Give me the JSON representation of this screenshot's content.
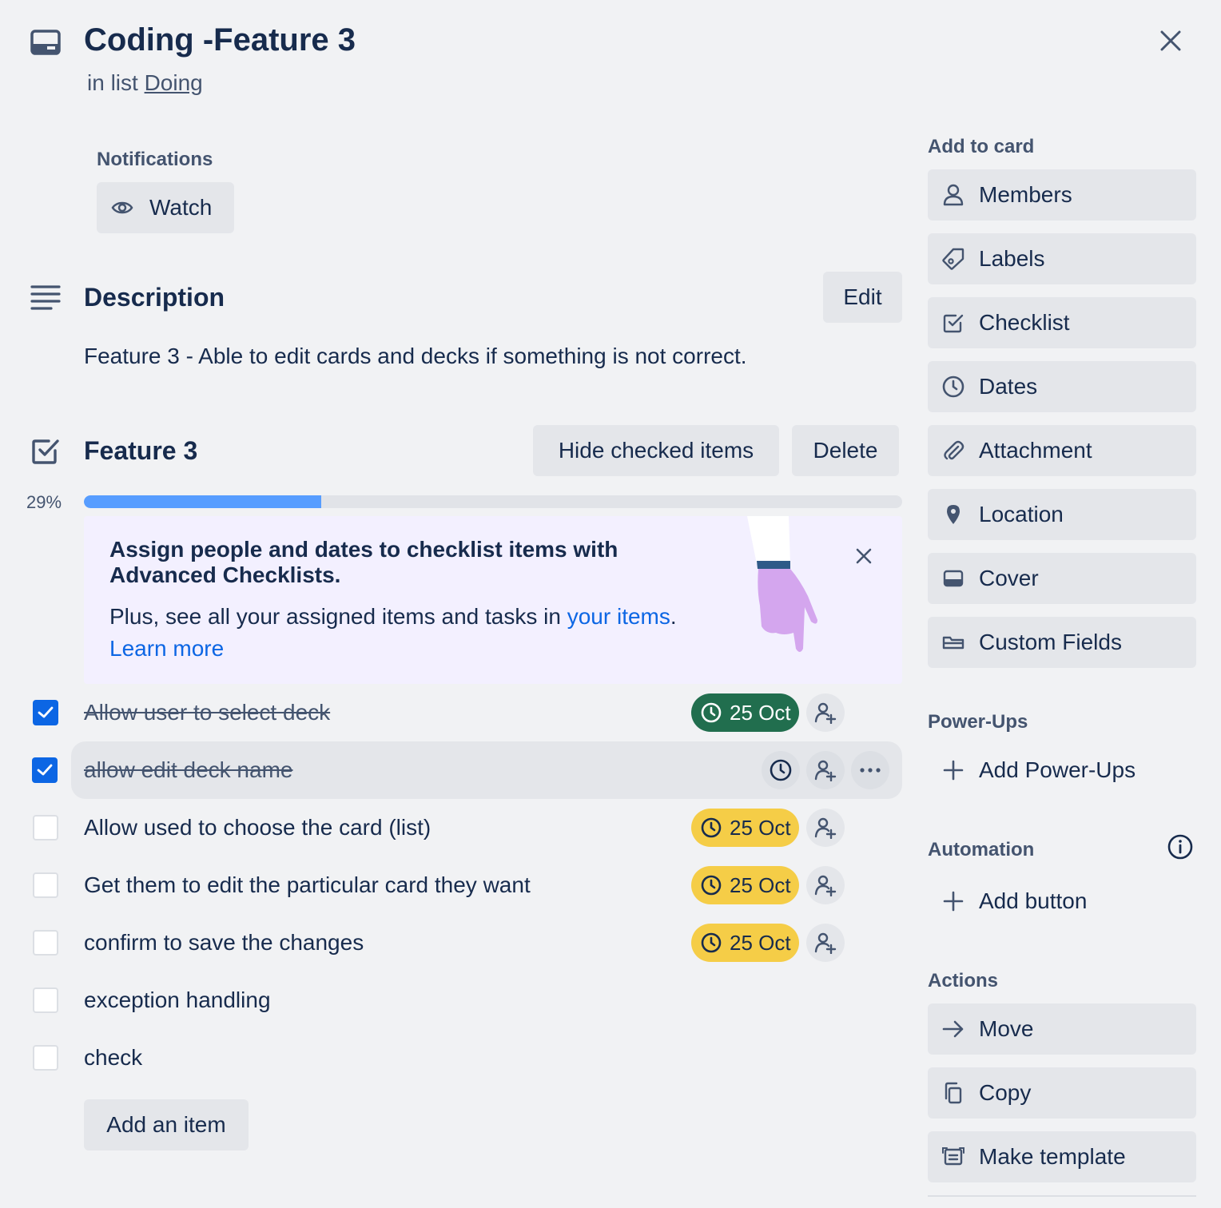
{
  "card": {
    "title": "Coding -Feature 3",
    "subtitle_prefix": "in list",
    "list_name": "Doing"
  },
  "notifications": {
    "heading": "Notifications",
    "watch_label": "Watch"
  },
  "description": {
    "heading": "Description",
    "edit_label": "Edit",
    "text": "Feature 3 - Able to edit cards and decks if something is not correct."
  },
  "checklist": {
    "title": "Feature 3",
    "hide_checked_label": "Hide checked items",
    "delete_label": "Delete",
    "progress_text": "29%",
    "progress_value": 0.29,
    "add_item_label": "Add an item",
    "items": [
      {
        "text": "Allow user to select deck",
        "checked": true,
        "due": "25 Oct",
        "due_status": "complete"
      },
      {
        "text": "allow edit deck name",
        "checked": true,
        "due": "",
        "due_status": "none"
      },
      {
        "text": "Allow used to choose the card (list)",
        "checked": false,
        "due": "25 Oct",
        "due_status": "due-soon"
      },
      {
        "text": "Get them to edit the particular card they want",
        "checked": false,
        "due": "25 Oct",
        "due_status": "due-soon"
      },
      {
        "text": "confirm to save the changes",
        "checked": false,
        "due": "25 Oct",
        "due_status": "due-soon"
      },
      {
        "text": "exception handling",
        "checked": false,
        "due": "",
        "due_status": "none"
      },
      {
        "text": "check",
        "checked": false,
        "due": "",
        "due_status": "none"
      }
    ]
  },
  "promo": {
    "title": "Assign people and dates to checklist items with Advanced Checklists.",
    "text_before": "Plus, see all your assigned items and tasks in ",
    "link_text": "your items",
    "text_after": ".",
    "learn_more": "Learn more"
  },
  "sidebar": {
    "add_to_card_heading": "Add to card",
    "add_to_card": [
      {
        "label": "Members",
        "icon": "person-icon"
      },
      {
        "label": "Labels",
        "icon": "tag-icon"
      },
      {
        "label": "Checklist",
        "icon": "checkbox-icon"
      },
      {
        "label": "Dates",
        "icon": "clock-icon"
      },
      {
        "label": "Attachment",
        "icon": "paperclip-icon"
      },
      {
        "label": "Location",
        "icon": "location-pin-icon"
      },
      {
        "label": "Cover",
        "icon": "cover-icon"
      },
      {
        "label": "Custom Fields",
        "icon": "custom-field-icon"
      }
    ],
    "powerups_heading": "Power-Ups",
    "add_powerups_label": "Add Power-Ups",
    "automation_heading": "Automation",
    "add_button_label": "Add button",
    "actions_heading": "Actions",
    "actions": [
      {
        "label": "Move",
        "icon": "arrow-right-icon"
      },
      {
        "label": "Copy",
        "icon": "copy-icon"
      },
      {
        "label": "Make template",
        "icon": "template-icon"
      }
    ]
  },
  "colors": {
    "background": "#f1f2f4",
    "button": "#e4e6ea",
    "primary_text": "#172b4d",
    "checkbox_checked": "#0c66e4",
    "progress_fill": "#579dff",
    "due_complete": "#216e4e",
    "due_soon": "#f5cd47",
    "link": "#0c66e4",
    "promo_bg": "#f3f0ff"
  }
}
